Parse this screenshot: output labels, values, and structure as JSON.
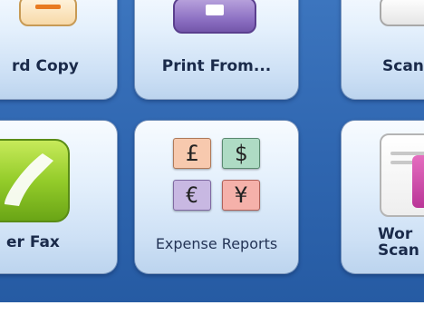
{
  "tiles": {
    "hard_copy": {
      "label": "rd Copy",
      "icon": "copy-icon"
    },
    "print_from": {
      "label": "Print From...",
      "icon": "print-tray-icon"
    },
    "scan": {
      "label": "Scan",
      "icon": "scan-icon"
    },
    "fax": {
      "label": "er Fax",
      "icon": "fax-phone-icon"
    },
    "expense_reports": {
      "label": "Expense Reports",
      "icon": "currency-icon",
      "symbols": {
        "pound": "£",
        "dollar": "$",
        "euro": "€",
        "yen": "¥"
      }
    },
    "workflow_scan": {
      "label_line1": "Wor",
      "label_line2": "Scan",
      "icon": "document-icon"
    }
  },
  "colors": {
    "background": "#2f66b0",
    "tile": "#dcebfa",
    "pound": "#f7c9ae",
    "dollar": "#aedbc4",
    "euro": "#c8b8e2",
    "yen": "#f5b1aa",
    "fax_green": "#94cc2a",
    "print_purple": "#8e72c4"
  }
}
